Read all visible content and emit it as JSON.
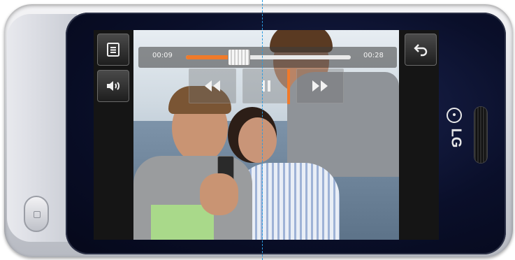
{
  "device": {
    "brand": "LG",
    "color": "#0a0f2a",
    "icons": {
      "menu": "list-icon",
      "volume": "speaker-icon",
      "back": "return-arrow-icon",
      "rewind": "rewind-icon",
      "pause": "pause-icon",
      "forward": "fast-forward-icon"
    }
  },
  "player": {
    "elapsed": "00:09",
    "remaining": "00:28",
    "progress_fraction": 0.32,
    "accent_color": "#f07a2a"
  }
}
